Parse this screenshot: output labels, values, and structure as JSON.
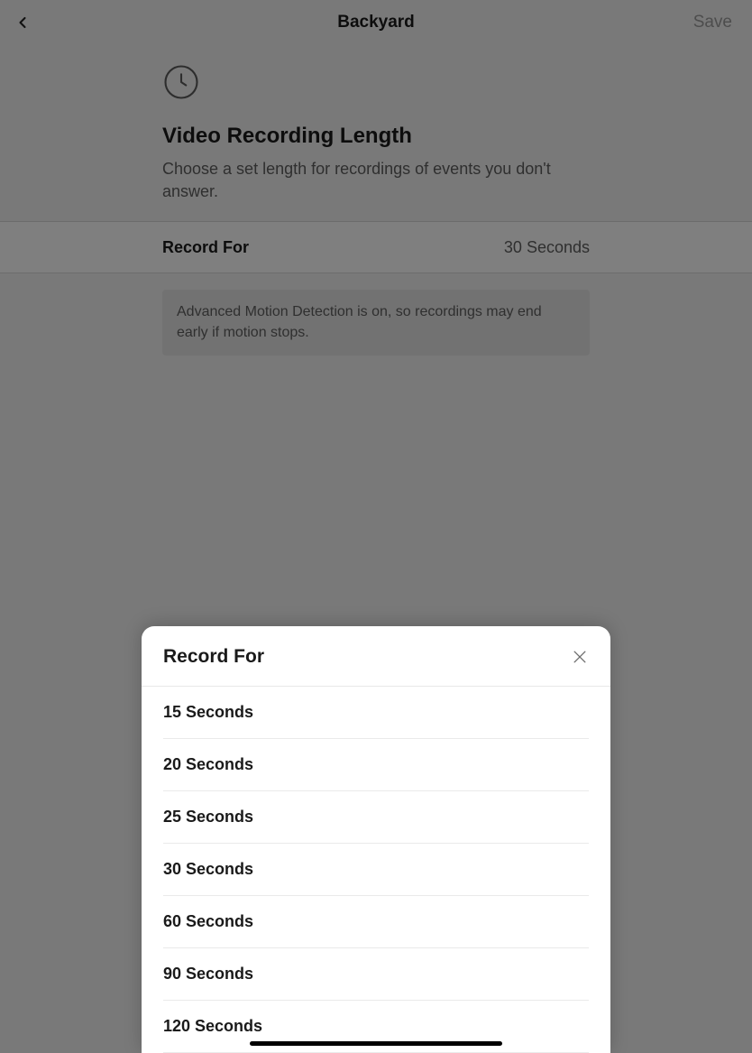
{
  "nav": {
    "title": "Backyard",
    "save_label": "Save"
  },
  "header": {
    "title": "Video Recording Length",
    "subtitle": "Choose a set length for recordings of events you don't answer."
  },
  "record_row": {
    "label": "Record For",
    "value": "30 Seconds"
  },
  "info": {
    "text": "Advanced Motion Detection is on, so recordings may end early if motion stops."
  },
  "modal": {
    "title": "Record For",
    "options": [
      "15 Seconds",
      "20 Seconds",
      "25 Seconds",
      "30 Seconds",
      "60 Seconds",
      "90 Seconds",
      "120 Seconds"
    ]
  }
}
